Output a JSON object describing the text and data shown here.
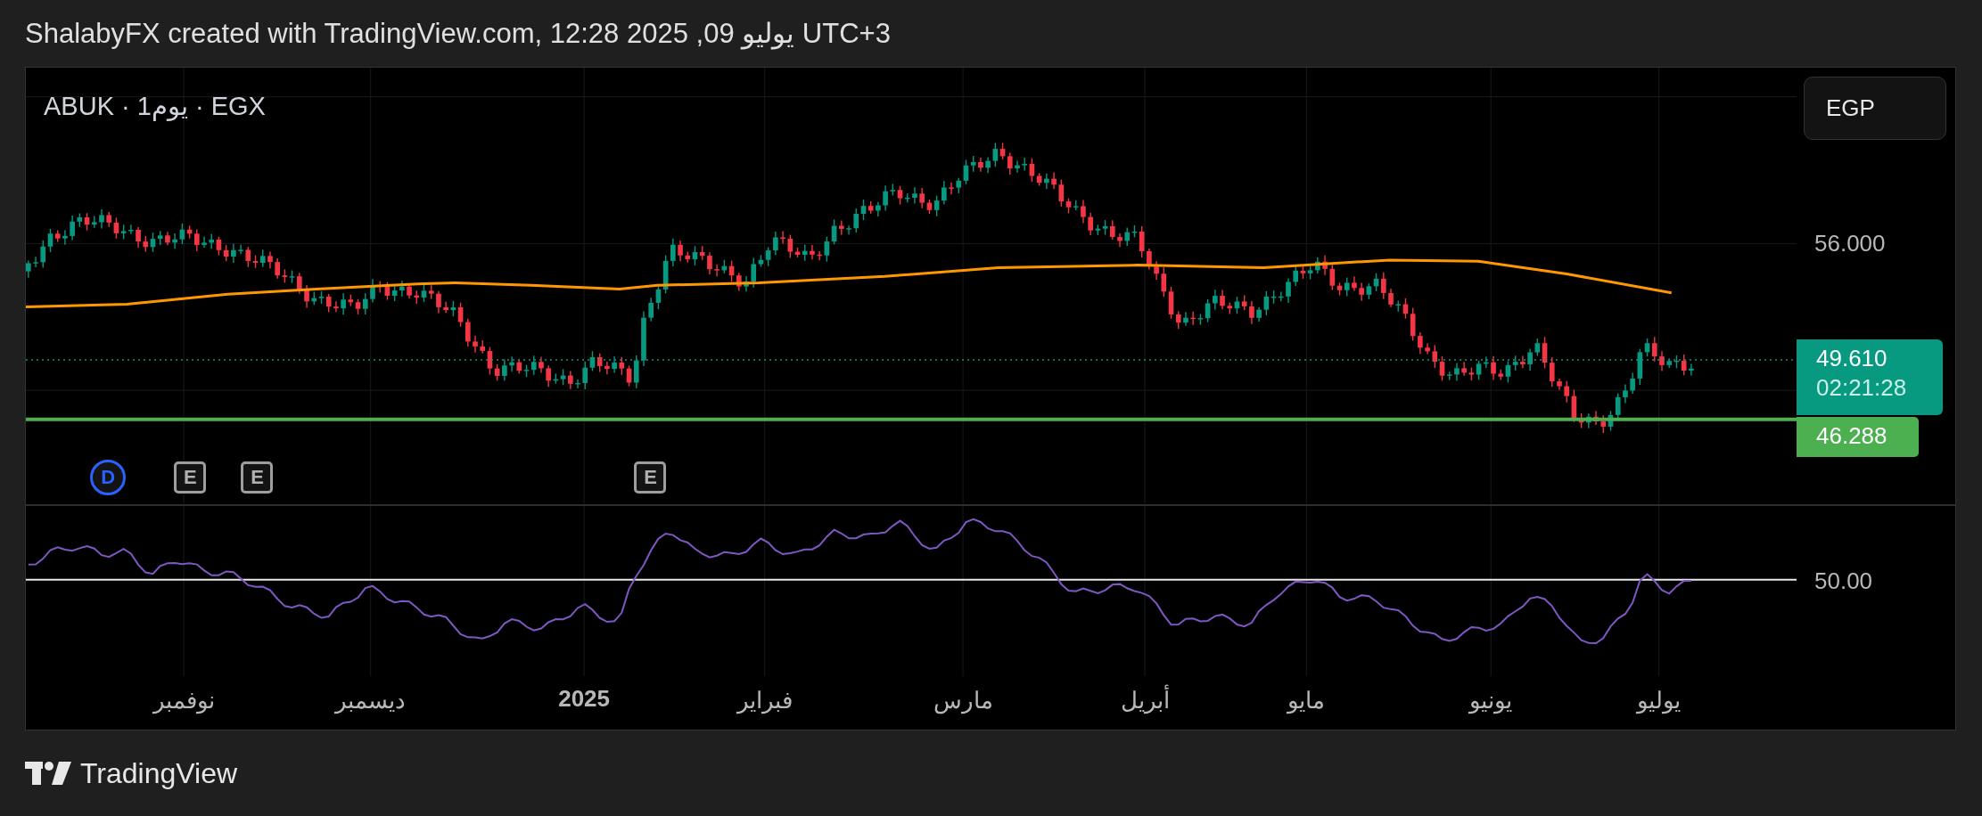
{
  "header": {
    "attribution": "ShalabyFX created with TradingView.com, يوليو 09, 2025 12:28 UTC+3"
  },
  "chart": {
    "legend": "ABUK · 1يوم · EGX",
    "currency_button": "EGP",
    "price_axis": {
      "ticks": [
        "56.000"
      ],
      "last_price": "49.610",
      "countdown": "02:21:28",
      "line_price": "46.288"
    },
    "events": [
      {
        "kind": "earnings",
        "label": "E"
      },
      {
        "kind": "earnings",
        "label": "E"
      },
      {
        "kind": "earnings",
        "label": "E"
      },
      {
        "kind": "dividend",
        "label": "D"
      }
    ],
    "rsi_axis": {
      "ticks": [
        "50.00"
      ]
    },
    "time_axis": [
      {
        "kind": "month",
        "label": "يوليو"
      },
      {
        "kind": "month",
        "label": "يونيو"
      },
      {
        "kind": "month",
        "label": "مايو"
      },
      {
        "kind": "month",
        "label": "أبريل"
      },
      {
        "kind": "month",
        "label": "مارس"
      },
      {
        "kind": "month",
        "label": "فبراير"
      },
      {
        "kind": "year",
        "label": "2025"
      },
      {
        "kind": "month",
        "label": "ديسمبر"
      },
      {
        "kind": "month",
        "label": "نوفمبر"
      }
    ]
  },
  "footer": {
    "logo_text": "TradingView"
  }
}
